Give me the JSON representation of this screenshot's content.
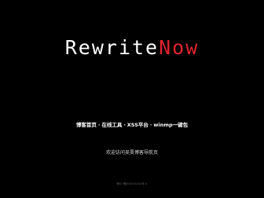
{
  "logo": {
    "part1": "Rewrite",
    "part2": "Now"
  },
  "nav": {
    "items": [
      "博客首页",
      "在线工具",
      "XSS平台",
      "winmp一键包"
    ],
    "separator": "·"
  },
  "welcome": "欢迎访问吴昊博客导航页",
  "footer": {
    "icp": "豫ICP备XXXXXXXX号-X"
  },
  "colors": {
    "background": "#000000",
    "logo_primary": "#ffffff",
    "logo_accent": "#e0242f",
    "nav_text": "#ffffff",
    "welcome_text": "#d8d8d8",
    "footer_text": "#5a5a5a"
  }
}
